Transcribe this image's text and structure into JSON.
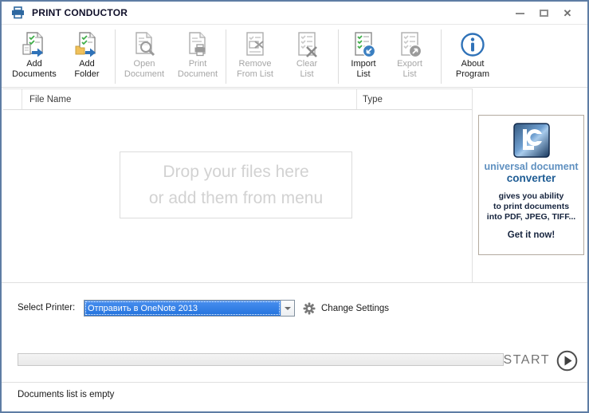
{
  "window": {
    "title": "PRINT CONDUCTOR",
    "controls": {
      "minimize": "minimize",
      "maximize": "maximize",
      "close": "close"
    }
  },
  "toolbar": {
    "buttons": [
      {
        "lines": [
          "Add",
          "Documents"
        ],
        "icon": "add-documents-icon",
        "enabled": true
      },
      {
        "lines": [
          "Add",
          "Folder"
        ],
        "icon": "add-folder-icon",
        "enabled": true
      },
      {
        "lines": [
          "Open",
          "Document"
        ],
        "icon": "open-document-icon",
        "enabled": false
      },
      {
        "lines": [
          "Print",
          "Document"
        ],
        "icon": "print-document-icon",
        "enabled": false
      },
      {
        "lines": [
          "Remove",
          "From List"
        ],
        "icon": "remove-from-list-icon",
        "enabled": false
      },
      {
        "lines": [
          "Clear",
          "List"
        ],
        "icon": "clear-list-icon",
        "enabled": false
      },
      {
        "lines": [
          "Import",
          "List"
        ],
        "icon": "import-list-icon",
        "enabled": true
      },
      {
        "lines": [
          "Export",
          "List"
        ],
        "icon": "export-list-icon",
        "enabled": false
      },
      {
        "lines": [
          "About",
          "Program"
        ],
        "icon": "about-program-icon",
        "enabled": true
      }
    ]
  },
  "file_list": {
    "columns": [
      "File Name",
      "Type"
    ],
    "dropzone_lines": [
      "Drop your files here",
      "or add them from menu"
    ]
  },
  "ad_banner": {
    "brand_top": "universal document",
    "brand_bottom": "converter",
    "body_lines": [
      "gives you ability",
      "to print documents",
      "into PDF, JPEG, TIFF..."
    ],
    "cta": "Get it now!"
  },
  "printer_row": {
    "label": "Select Printer:",
    "selected_printer": "Отправить в OneNote 2013",
    "change_settings": "Change Settings"
  },
  "start_row": {
    "start_label": "START",
    "progress_percent": 0
  },
  "status_bar": {
    "text": "Documents list is empty"
  },
  "colors": {
    "window_border": "#5e7da4",
    "selection_blue": "#2f7fe0",
    "accent_blue": "#2f72b8",
    "check_green": "#3fae49",
    "folder_yellow": "#f0c05a",
    "disabled_gray": "#a6a6a6",
    "ad_navy": "#16243e",
    "ad_blue_light": "#5f90c0",
    "ad_blue_dark": "#1e5c94"
  }
}
